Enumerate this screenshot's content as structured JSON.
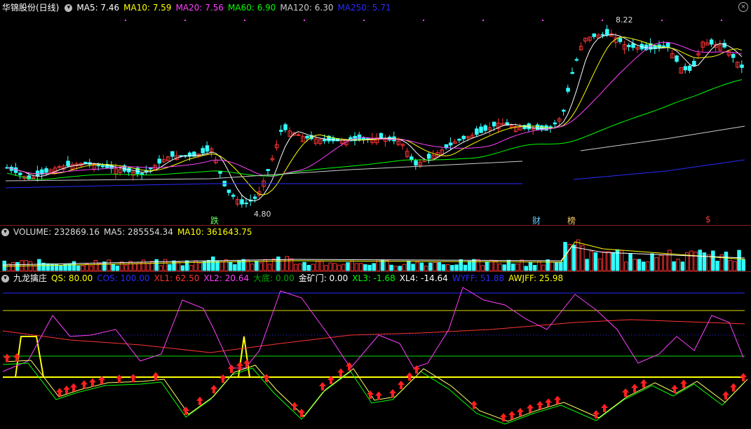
{
  "main": {
    "title": "华锦股份(日线)",
    "ma": [
      {
        "label": "MA5: 7.46",
        "color": "#ffffff"
      },
      {
        "label": "MA10: 7.59",
        "color": "#ffff00"
      },
      {
        "label": "MA20: 7.56",
        "color": "#ff40ff"
      },
      {
        "label": "MA60: 6.90",
        "color": "#00ff00"
      },
      {
        "label": "MA120: 6.30",
        "color": "#cccccc"
      },
      {
        "label": "MA250: 5.71",
        "color": "#2a2aff"
      }
    ],
    "high_label": "8.22",
    "low_label": "4.80",
    "markers": [
      {
        "text": "跌",
        "color": "#66ff66"
      },
      {
        "text": "财",
        "color": "#66ccff"
      },
      {
        "text": "榜",
        "color": "#ffcc66"
      },
      {
        "text": "$",
        "color": "#ff3333"
      }
    ]
  },
  "volume": {
    "items": [
      {
        "label": "VOLUME: 232869.16",
        "color": "#dddddd"
      },
      {
        "label": "MA5: 285554.34",
        "color": "#dddddd"
      },
      {
        "label": "MA10: 361643.75",
        "color": "#ffff00"
      }
    ]
  },
  "indicator": {
    "title": "九龙擒庄",
    "items": [
      {
        "label": "QS: 80.00",
        "color": "#ffff00"
      },
      {
        "label": "COS: 100.00",
        "color": "#2a2aff"
      },
      {
        "label": "XL1: 62.50",
        "color": "#ff3333"
      },
      {
        "label": "XL2: 20.64",
        "color": "#ff40ff"
      },
      {
        "label": "大底: 0.00",
        "color": "#00aa00"
      },
      {
        "label": "金矿门: 0.00",
        "color": "#ffffff"
      },
      {
        "label": "XL3: -1.68",
        "color": "#00ff00"
      },
      {
        "label": "XL4: -14.64",
        "color": "#ffffff"
      },
      {
        "label": "WYFF: 51.88",
        "color": "#2a2aff"
      },
      {
        "label": "AWJFF: 25.98",
        "color": "#ffff00"
      }
    ]
  },
  "colors": {
    "up": "#ff3333",
    "down": "#33ffff",
    "bg": "#000000"
  }
}
